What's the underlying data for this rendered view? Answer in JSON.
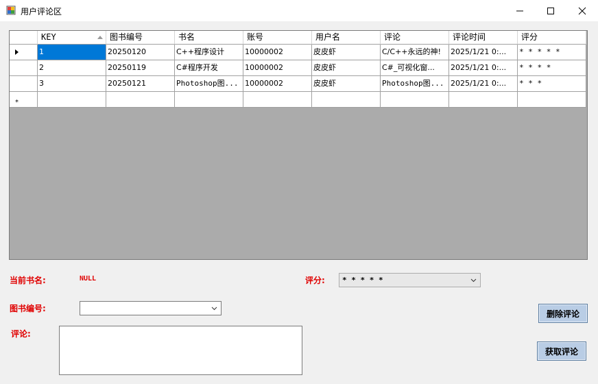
{
  "window": {
    "title": "用户评论区"
  },
  "grid": {
    "columns": [
      "KEY",
      "图书编号",
      "书名",
      "账号",
      "用户名",
      "评论",
      "评论时间",
      "评分"
    ],
    "rows": [
      [
        "1",
        "20250120",
        "C++程序设计",
        "10000002",
        "皮皮虾",
        "C/C++永远的神!",
        "2025/1/21 0:...",
        "* * * * *"
      ],
      [
        "2",
        "20250119",
        "C#程序开发",
        "10000002",
        "皮皮虾",
        "C#_可视化窗...",
        "2025/1/21 0:...",
        "* * * *"
      ],
      [
        "3",
        "20250121",
        "Photoshop图...",
        "10000002",
        "皮皮虾",
        "Photoshop图...",
        "2025/1/21 0:...",
        "* * *"
      ]
    ],
    "new_row_marker": "*",
    "sort_column": "KEY"
  },
  "form": {
    "current_book_label": "当前书名:",
    "current_book_value": "NULL",
    "rating_label": "评分:",
    "rating_value": "* * * * *",
    "book_id_label": "图书编号:",
    "book_id_value": "",
    "comment_label": "评论:",
    "comment_value": ""
  },
  "buttons": {
    "delete": "删除评论",
    "fetch": "获取评论"
  },
  "colors": {
    "label_red": "#e00000",
    "selection_blue": "#0078d7",
    "button_bg": "#b9cde5",
    "grid_bg": "#ababab"
  }
}
